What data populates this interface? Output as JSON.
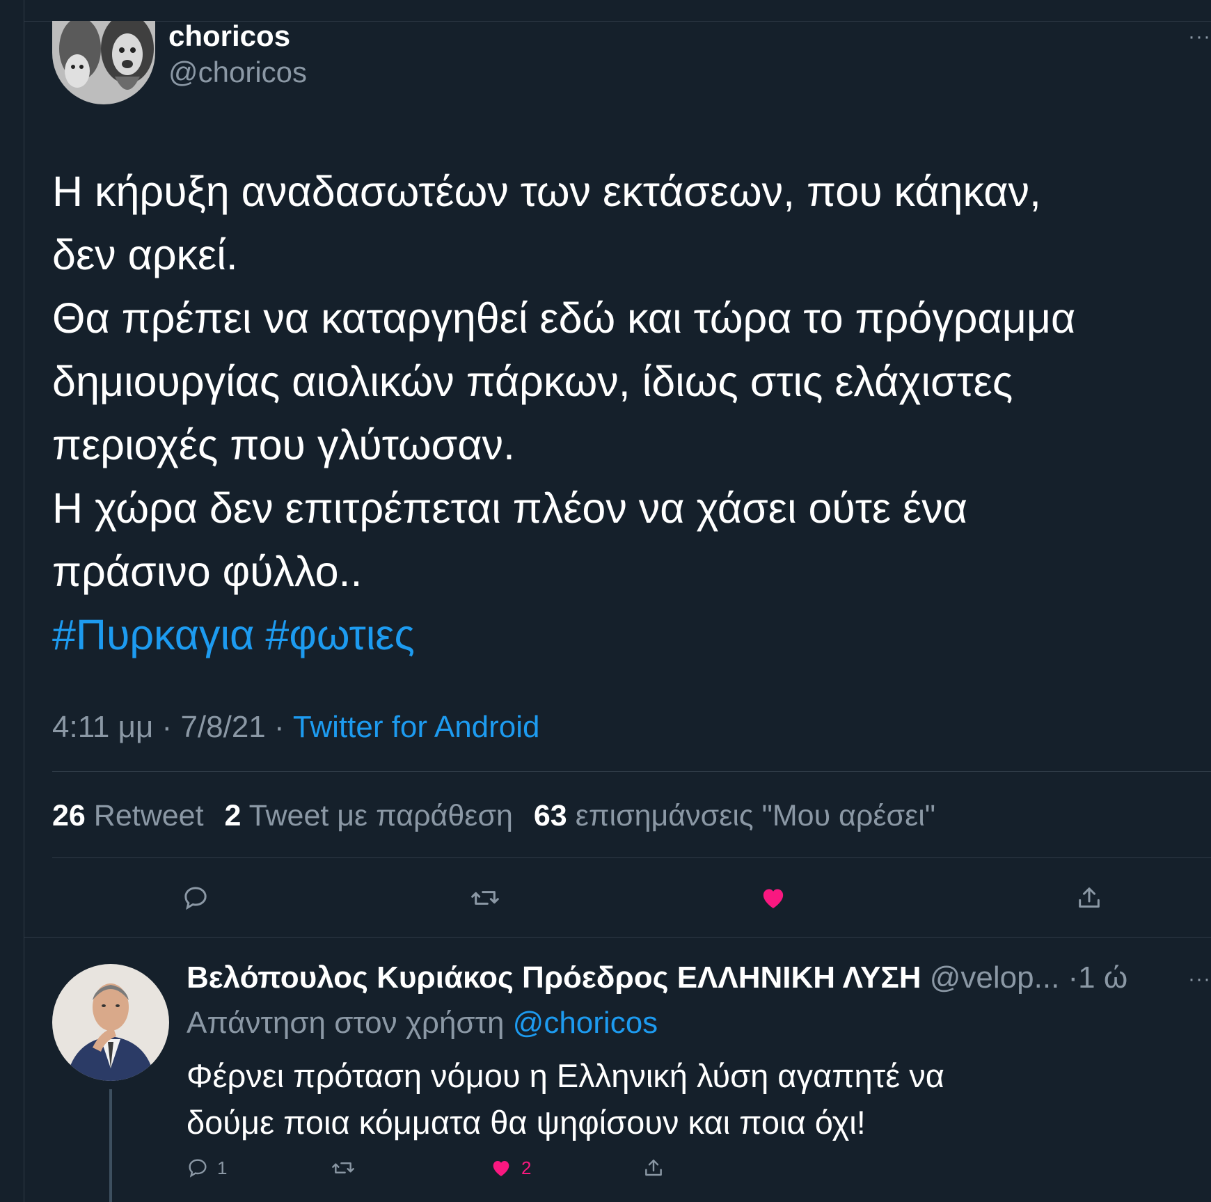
{
  "tweet": {
    "author": {
      "name": "choricos",
      "handle": "@choricos"
    },
    "more_icon": "more-horizontal-icon",
    "text_lines": [
      "Η κήρυξη αναδασωτέων των εκτάσεων, που κάηκαν,",
      "δεν αρκεί.",
      "Θα πρέπει να καταργηθεί εδώ και τώρα το πρόγραμμα",
      "δημιουργίας αιολικών πάρκων, ίδιως στις ελάχιστες",
      "περιοχές που γλύτωσαν.",
      "Η χώρα δεν επιτρέπεται πλέον να χάσει ούτε ένα",
      "πράσινο φύλλο.."
    ],
    "hashtags": [
      "#Πυρκαγια",
      "#φωτιες"
    ],
    "time": "4:11 μμ",
    "date": "7/8/21",
    "separator": "·",
    "source": "Twitter for Android",
    "stats": {
      "retweets_count": "26",
      "retweets_label": "Retweet",
      "quotes_count": "2",
      "quotes_label": "Tweet με παράθεση",
      "likes_count": "63",
      "likes_label": "επισημάνσεις \"Μου αρέσει\""
    },
    "actions": [
      "reply-icon",
      "retweet-icon",
      "like-filled-icon",
      "share-icon"
    ]
  },
  "reply": {
    "author": {
      "name": "Βελόπουλος Κυριάκος Πρόεδρος ΕΛΛΗΝΙΚΗ ΛΥΣΗ",
      "handle": "@velop...",
      "time": "·1 ώ"
    },
    "reply_to_label": "Απάντηση στον χρήστη",
    "reply_to_mention": "@choricos",
    "text_lines": [
      "Φέρνει πρόταση νόμου η Ελληνική λύση αγαπητέ να",
      "δούμε ποια κόμματα θα ψηφίσουν και ποια όχι!"
    ],
    "reply_count": "1",
    "like_count": "2"
  },
  "colors": {
    "background": "#15202b",
    "text": "#ffffff",
    "muted": "#8b98a5",
    "link": "#1d9bf0",
    "like": "#f91880",
    "divider": "#2f3b47"
  }
}
